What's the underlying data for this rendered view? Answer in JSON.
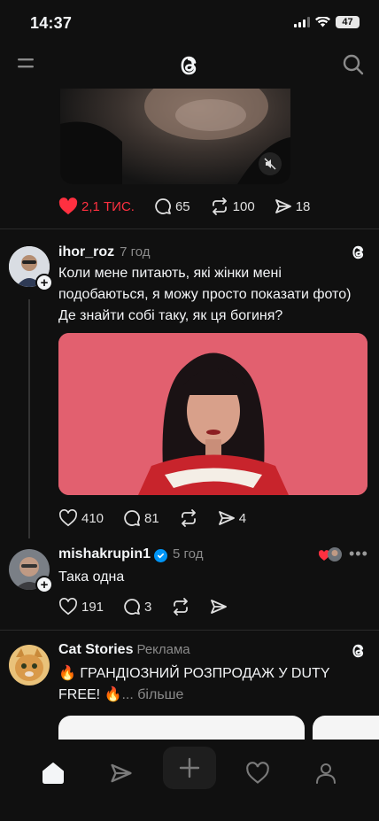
{
  "status": {
    "time": "14:37",
    "battery": "47"
  },
  "post1": {
    "likes": "2,1 ТИС.",
    "comments": "65",
    "reposts": "100",
    "shares": "18"
  },
  "post2": {
    "username": "ihor_roz",
    "time": "7 год",
    "text": "Коли мене питають, які жінки мені подобаються, я можу просто показати фото) Де знайти собі таку, як ця богиня?",
    "likes": "410",
    "comments": "81",
    "shares": "4"
  },
  "reply": {
    "username": "mishakrupin1",
    "time": "5 год",
    "text": "Така одна",
    "likes": "191",
    "comments": "3"
  },
  "ad": {
    "username": "Cat Stories",
    "label": "Реклама",
    "text": "🔥 ГРАНДІОЗНИЙ РОЗПРОДАЖ У DUTY FREE! 🔥",
    "more": "... більше"
  },
  "colors": {
    "background": "#101010",
    "like_red": "#ff3040",
    "verified_blue": "#0095f6"
  }
}
